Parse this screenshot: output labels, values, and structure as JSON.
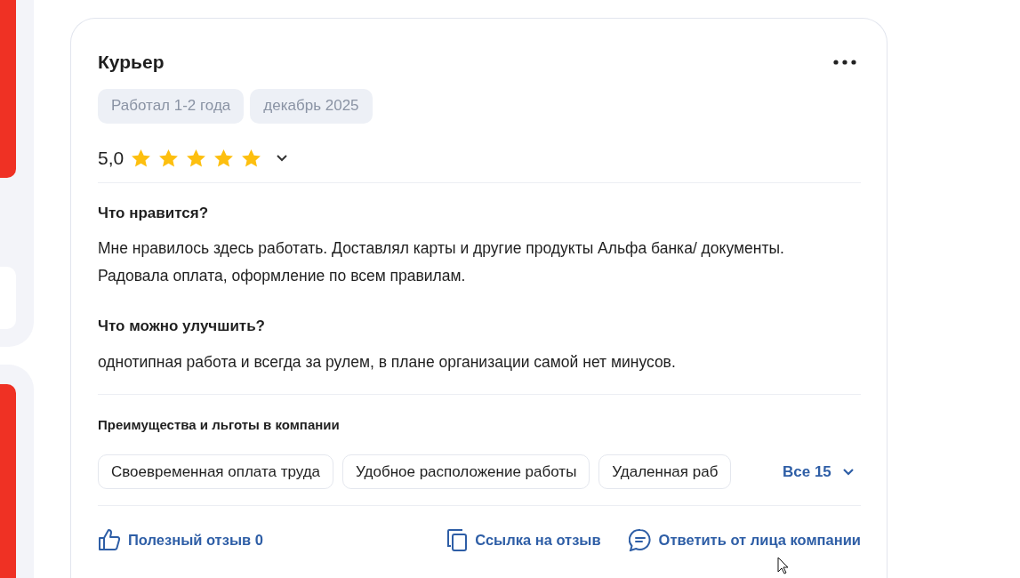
{
  "review": {
    "position": "Курьер",
    "tags": [
      "Работал 1-2 года",
      "декабрь 2025"
    ],
    "rating": "5,0",
    "stars": 5,
    "sections": [
      {
        "heading": "Что нравится?",
        "text": "Мне нравилось здесь работать. Доставлял карты и другие продукты Альфа банка/ документы. Радовала оплата, оформление по всем правилам."
      },
      {
        "heading": "Что можно улучшить?",
        "text": "однотипная работа и всегда за рулем, в плане организации самой нет минусов."
      }
    ],
    "benefits": {
      "heading": "Преимущества и льготы в компании",
      "items": [
        "Своевременная оплата труда",
        "Удобное расположение работы",
        "Удаленная раб"
      ],
      "more": "Все 15"
    },
    "actions": [
      {
        "kind": "like",
        "label": "Полезный отзыв 0"
      },
      {
        "kind": "link",
        "label": "Ссылка на отзыв"
      },
      {
        "kind": "reply",
        "label": "Ответить от лица компании"
      }
    ]
  }
}
